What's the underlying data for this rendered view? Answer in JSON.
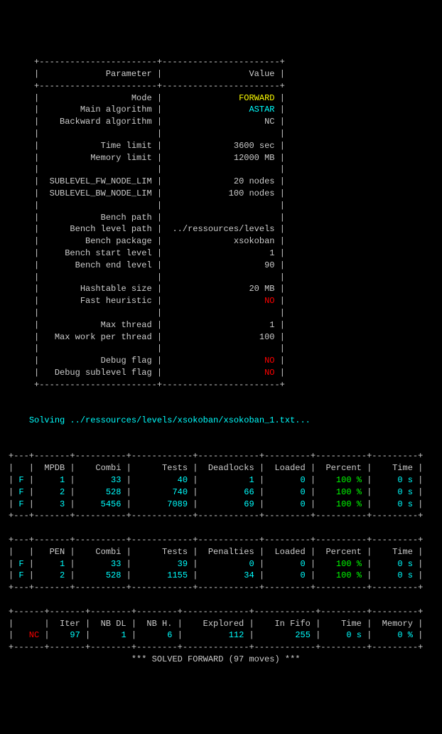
{
  "params_table": {
    "header": {
      "param": "Parameter",
      "value": "Value"
    },
    "rows": [
      {
        "label": "Mode",
        "value": "FORWARD",
        "color": "yellow"
      },
      {
        "label": "Main algorithm",
        "value": "ASTAR",
        "color": "cyan"
      },
      {
        "label": "Backward algorithm",
        "value": "NC",
        "color": "grey"
      },
      {
        "label": "Time limit",
        "value": "3600 sec",
        "color": "grey",
        "gap_before": true
      },
      {
        "label": "Memory limit",
        "value": "12000 MB",
        "color": "grey"
      },
      {
        "label": "SUBLEVEL_FW_NODE_LIM",
        "value": "20 nodes",
        "color": "grey",
        "gap_before": true
      },
      {
        "label": "SUBLEVEL_BW_NODE_LIM",
        "value": "100 nodes",
        "color": "grey"
      },
      {
        "label": "Bench path",
        "value": "",
        "color": "grey",
        "gap_before": true
      },
      {
        "label": "Bench level path",
        "value": "../ressources/levels",
        "color": "grey"
      },
      {
        "label": "Bench package",
        "value": "xsokoban",
        "color": "grey"
      },
      {
        "label": "Bench start level",
        "value": "1",
        "color": "grey"
      },
      {
        "label": "Bench end level",
        "value": "90",
        "color": "grey"
      },
      {
        "label": "Hashtable size",
        "value": "20 MB",
        "color": "grey",
        "gap_before": true
      },
      {
        "label": "Fast heuristic",
        "value": "NO",
        "color": "red"
      },
      {
        "label": "Max thread",
        "value": "1",
        "color": "grey",
        "gap_before": true
      },
      {
        "label": "Max work per thread",
        "value": "100",
        "color": "grey"
      },
      {
        "label": "Debug flag",
        "value": "NO",
        "color": "red",
        "gap_before": true
      },
      {
        "label": "Debug sublevel flag",
        "value": "NO",
        "color": "red"
      }
    ]
  },
  "solving_line": "Solving ../ressources/levels/xsokoban/xsokoban_1.txt...",
  "mpdb_table": {
    "headers": [
      "",
      "MPDB",
      "Combi",
      "Tests",
      "Deadlocks",
      "Loaded",
      "Percent",
      "Time"
    ],
    "rows": [
      {
        "flag": "F",
        "mpdb": "1",
        "combi": "33",
        "tests": "40",
        "deadlocks": "1",
        "loaded": "0",
        "percent": "100 %",
        "time": "0 s"
      },
      {
        "flag": "F",
        "mpdb": "2",
        "combi": "528",
        "tests": "740",
        "deadlocks": "66",
        "loaded": "0",
        "percent": "100 %",
        "time": "0 s"
      },
      {
        "flag": "F",
        "mpdb": "3",
        "combi": "5456",
        "tests": "7089",
        "deadlocks": "69",
        "loaded": "0",
        "percent": "100 %",
        "time": "0 s"
      }
    ]
  },
  "pen_table": {
    "headers": [
      "",
      "PEN",
      "Combi",
      "Tests",
      "Penalties",
      "Loaded",
      "Percent",
      "Time"
    ],
    "rows": [
      {
        "flag": "F",
        "pen": "1",
        "combi": "33",
        "tests": "39",
        "penalties": "0",
        "loaded": "0",
        "percent": "100 %",
        "time": "0 s"
      },
      {
        "flag": "F",
        "pen": "2",
        "combi": "528",
        "tests": "1155",
        "penalties": "34",
        "loaded": "0",
        "percent": "100 %",
        "time": "0 s"
      }
    ]
  },
  "summary_table": {
    "headers": [
      "",
      "Iter",
      "NB DL",
      "NB H.",
      "Explored",
      "In Fifo",
      "Time",
      "Memory"
    ],
    "row": {
      "tag": "NC",
      "iter": "97",
      "nbdl": "1",
      "nbh": "6",
      "explored": "112",
      "infifo": "255",
      "time": "0 s",
      "memory": "0 %"
    }
  },
  "solved_line": "*** SOLVED FORWARD (97 moves) ***"
}
